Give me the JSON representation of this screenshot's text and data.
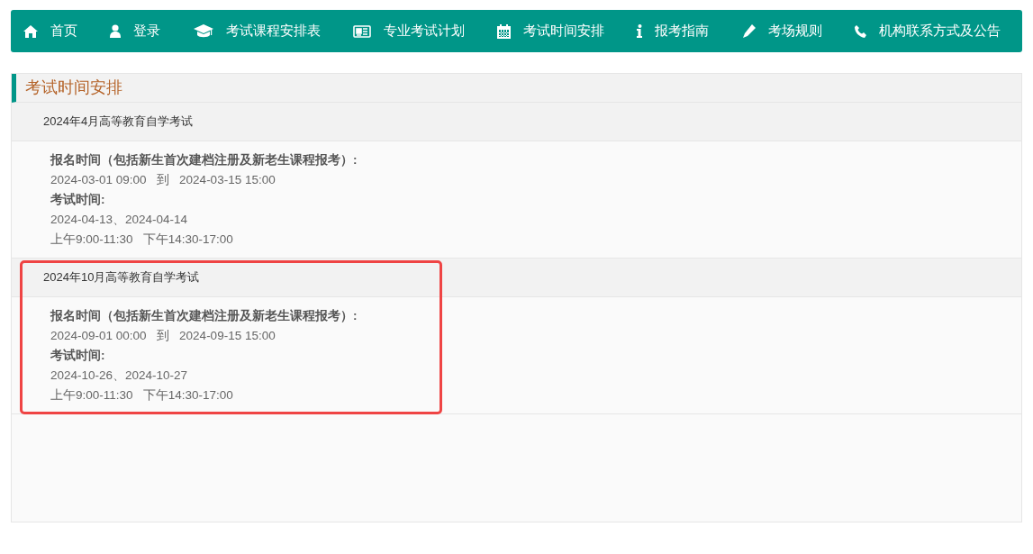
{
  "nav": [
    {
      "label": "首页"
    },
    {
      "label": "登录"
    },
    {
      "label": "考试课程安排表"
    },
    {
      "label": "专业考试计划"
    },
    {
      "label": "考试时间安排"
    },
    {
      "label": "报考指南"
    },
    {
      "label": "考场规则"
    },
    {
      "label": "机构联系方式及公告"
    }
  ],
  "panel": {
    "title": "考试时间安排",
    "sections": [
      {
        "title": "2024年4月高等教育自学考试",
        "highlighted": false,
        "lines": [
          {
            "kind": "label",
            "text": "报名时间（包括新生首次建档注册及新老生课程报考）:"
          },
          {
            "kind": "value",
            "text": "2024-03-01 09:00   到   2024-03-15 15:00"
          },
          {
            "kind": "label",
            "text": "考试时间:"
          },
          {
            "kind": "value",
            "text": "2024-04-13、2024-04-14"
          },
          {
            "kind": "value",
            "text": "上午9:00-11:30   下午14:30-17:00"
          }
        ]
      },
      {
        "title": "2024年10月高等教育自学考试",
        "highlighted": true,
        "lines": [
          {
            "kind": "label",
            "text": "报名时间（包括新生首次建档注册及新老生课程报考）:"
          },
          {
            "kind": "value",
            "text": "2024-09-01 00:00   到   2024-09-15 15:00"
          },
          {
            "kind": "label",
            "text": "考试时间:"
          },
          {
            "kind": "value",
            "text": "2024-10-26、2024-10-27"
          },
          {
            "kind": "value",
            "text": "上午9:00-11:30   下午14:30-17:00"
          }
        ]
      }
    ]
  }
}
